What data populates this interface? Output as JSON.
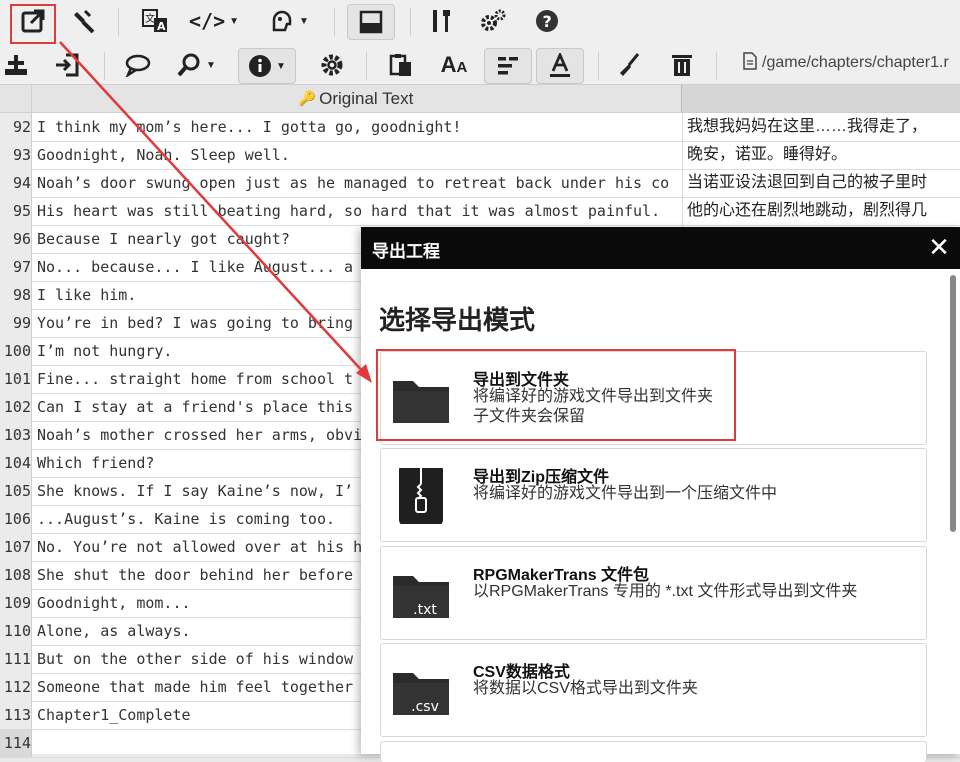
{
  "toolbar": {
    "top_icons": [
      "export-icon",
      "hammer-icon",
      "translate-icon",
      "code-icon",
      "user-icon",
      "window-icon",
      "tools-icon",
      "gears-icon",
      "help-icon"
    ],
    "second_icons": [
      "add-row-icon",
      "import-icon",
      "comment-icon",
      "search-icon",
      "info-icon",
      "settings-icon",
      "paste-icon",
      "font-size-icon",
      "align-icon",
      "text-color-icon",
      "brush-icon",
      "trash-icon"
    ],
    "file_path": "/game/chapters/chapter1.r"
  },
  "grid": {
    "header_original": "Original Text",
    "rows": [
      {
        "num": "92",
        "orig": "I think my mom’s here... I gotta go, goodnight!",
        "trans": "我想我妈妈在这里……我得走了，"
      },
      {
        "num": "93",
        "orig": "Goodnight, Noah. Sleep well.",
        "trans": "晚安，诺亚。睡得好。"
      },
      {
        "num": "94",
        "orig": "Noah’s door swung open just as he managed to retreat back under his co",
        "trans": "当诺亚设法退回到自己的被子里时"
      },
      {
        "num": "95",
        "orig": "His heart was still beating hard, so hard that it was almost painful.",
        "trans": "他的心还在剧烈地跳动，剧烈得几"
      },
      {
        "num": "96",
        "orig": "Because I nearly got caught?",
        "trans": ""
      },
      {
        "num": "97",
        "orig": "No... because... I like August... a",
        "trans": ""
      },
      {
        "num": "98",
        "orig": "I like him.",
        "trans": ""
      },
      {
        "num": "99",
        "orig": "You’re in bed? I was going to bring",
        "trans": ""
      },
      {
        "num": "100",
        "orig": "I’m not hungry.",
        "trans": ""
      },
      {
        "num": "101",
        "orig": "Fine... straight home from school t",
        "trans": ""
      },
      {
        "num": "102",
        "orig": "Can I stay at a friend's place this",
        "trans": ""
      },
      {
        "num": "103",
        "orig": "Noah’s mother crossed her arms, obvi",
        "trans": ""
      },
      {
        "num": "104",
        "orig": "Which friend?",
        "trans": ""
      },
      {
        "num": "105",
        "orig": "She knows. If I say Kaine’s now, I’",
        "trans": ""
      },
      {
        "num": "106",
        "orig": "...August’s. Kaine is coming too.",
        "trans": ""
      },
      {
        "num": "107",
        "orig": "No. You’re not allowed over at his h",
        "trans": ""
      },
      {
        "num": "108",
        "orig": "She shut the door behind her before",
        "trans": ""
      },
      {
        "num": "109",
        "orig": "Goodnight, mom...",
        "trans": ""
      },
      {
        "num": "110",
        "orig": "Alone, as always.",
        "trans": ""
      },
      {
        "num": "111",
        "orig": "But on the other side of his window",
        "trans": ""
      },
      {
        "num": "112",
        "orig": "Someone that made him feel together",
        "trans": ""
      },
      {
        "num": "113",
        "orig": "Chapter1_Complete",
        "trans": ""
      },
      {
        "num": "114",
        "orig": "",
        "trans": ""
      }
    ]
  },
  "dialog": {
    "title": "导出工程",
    "close": "✕",
    "heading": "选择导出模式",
    "options": [
      {
        "icon": "folder-icon",
        "title": "导出到文件夹",
        "desc1": "将编译好的游戏文件导出到文件夹",
        "desc2": "子文件夹会保留",
        "badge": ""
      },
      {
        "icon": "zip-icon",
        "title": "导出到Zip压缩文件",
        "desc1": "将编译好的游戏文件导出到一个压缩文件中",
        "desc2": "",
        "badge": ""
      },
      {
        "icon": "txt-folder-icon",
        "title": "RPGMakerTrans 文件包",
        "desc1": "以RPGMakerTrans 专用的 *.txt 文件形式导出到文件夹",
        "desc2": "",
        "badge": ".txt"
      },
      {
        "icon": "csv-folder-icon",
        "title": "CSV数据格式",
        "desc1": "将数据以CSV格式导出到文件夹",
        "desc2": "",
        "badge": ".csv"
      }
    ]
  },
  "colors": {
    "annotation": "#e03a3a",
    "dialog_header": "#0a0a0a",
    "icon_dark": "#2b2b2b"
  }
}
